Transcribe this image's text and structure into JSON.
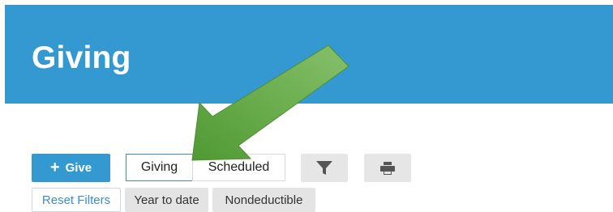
{
  "header": {
    "title": "Giving",
    "background_color": "#3399d0"
  },
  "toolbar": {
    "give_button": {
      "icon": "plus-icon",
      "label": "+ Give",
      "text": "Give"
    },
    "segments": [
      {
        "label": "Giving",
        "selected": true
      },
      {
        "label": "Scheduled",
        "selected": false
      }
    ],
    "filter_icon": "funnel-icon",
    "print_icon": "printer-icon"
  },
  "filters": {
    "reset_label": "Reset Filters",
    "chips": [
      "Year to date",
      "Nondeductible"
    ]
  },
  "annotation": {
    "icon": "green-arrow",
    "color": "#6ab04c"
  }
}
